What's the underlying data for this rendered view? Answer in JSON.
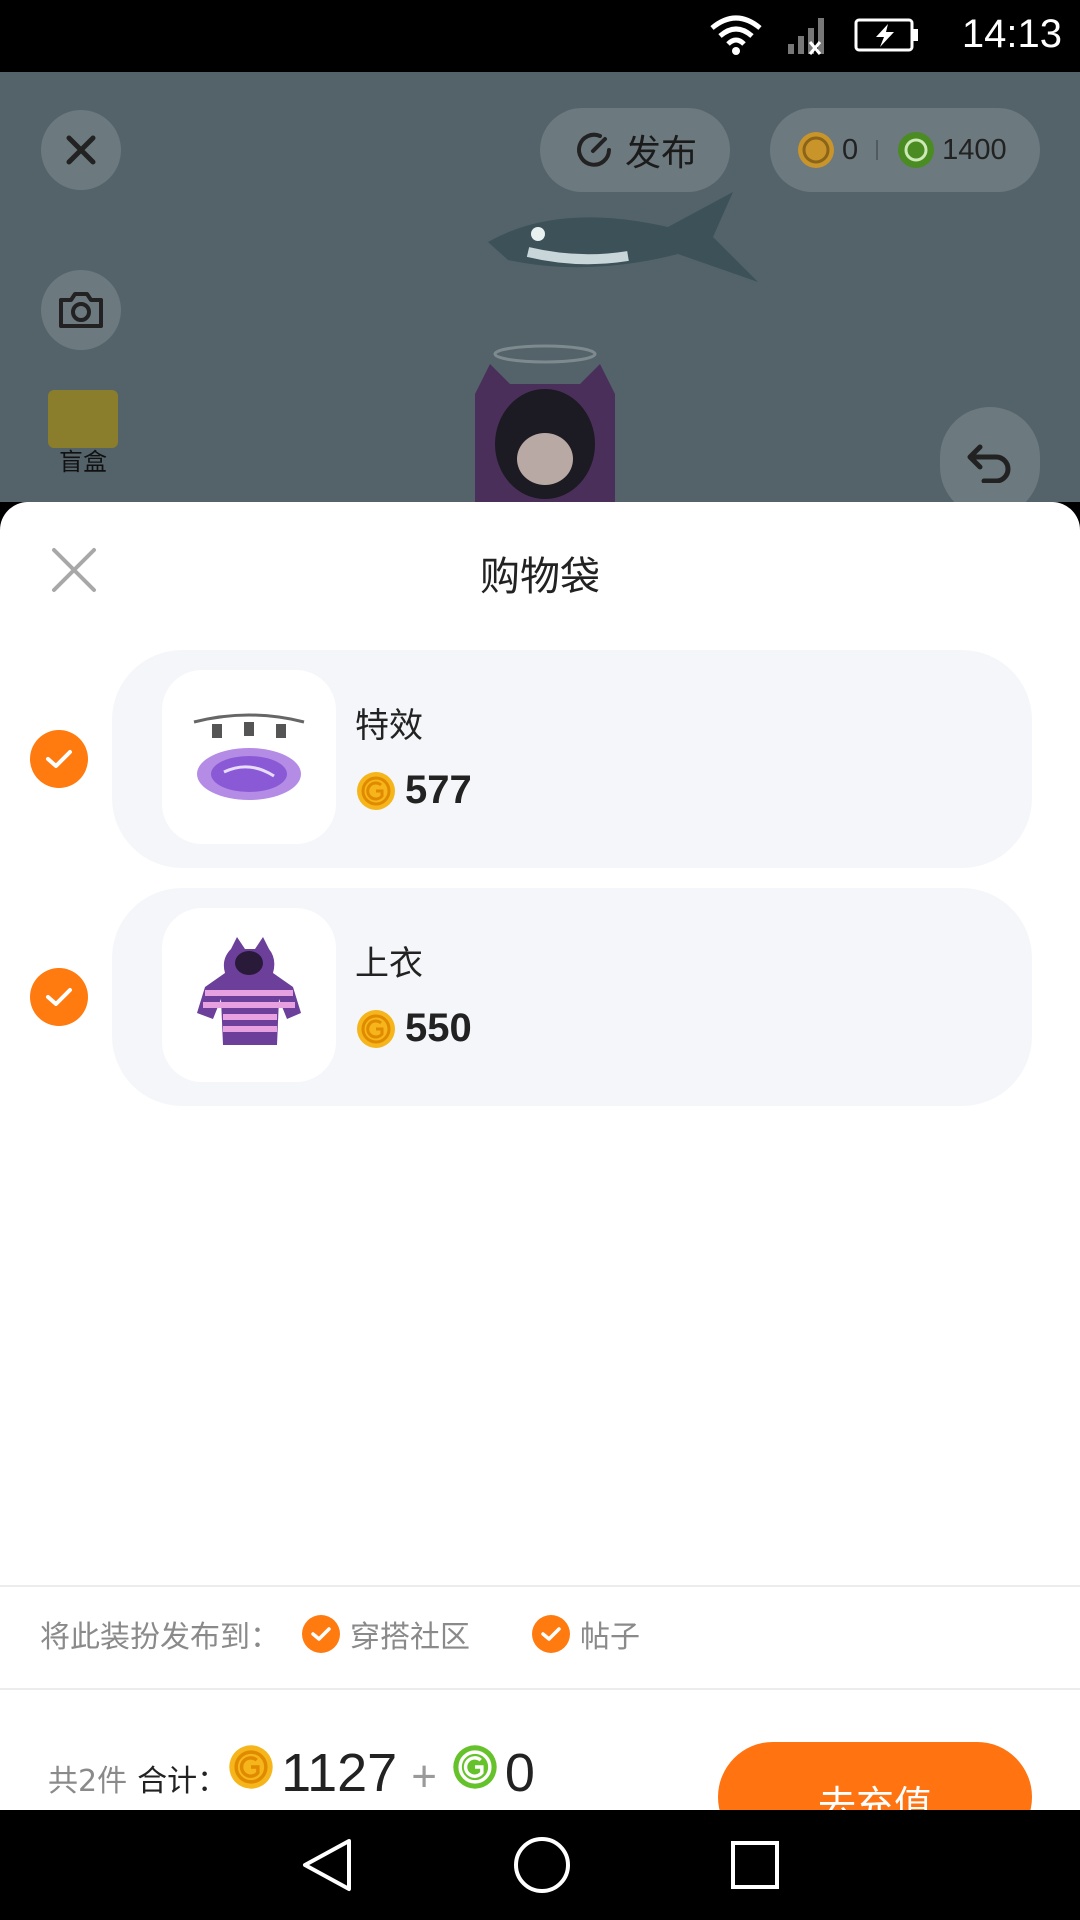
{
  "status_bar": {
    "time": "14:13",
    "icons": [
      "wifi-icon",
      "signal-icon",
      "battery-charging-icon"
    ]
  },
  "scene": {
    "publish_label": "发布",
    "gold_balance": "0",
    "green_balance": "1400",
    "blindbox_label": "盲盒"
  },
  "sheet": {
    "title": "购物袋",
    "items": [
      {
        "name": "特效",
        "price": "577",
        "selected": true
      },
      {
        "name": "上衣",
        "price": "550",
        "selected": true
      }
    ],
    "publish_to_label": "将此装扮发布到：",
    "publish_targets": [
      {
        "label": "穿搭社区",
        "checked": true
      },
      {
        "label": "帖子",
        "checked": true
      }
    ],
    "count_label": "共2件",
    "total_label": "合计：",
    "total_gold": "1127",
    "plus": "+",
    "total_green": "0",
    "recharge_label": "去充值"
  },
  "colors": {
    "accent": "#ff7a0f",
    "gold_coin": "#f5b51b",
    "green_coin": "#66c22a"
  }
}
